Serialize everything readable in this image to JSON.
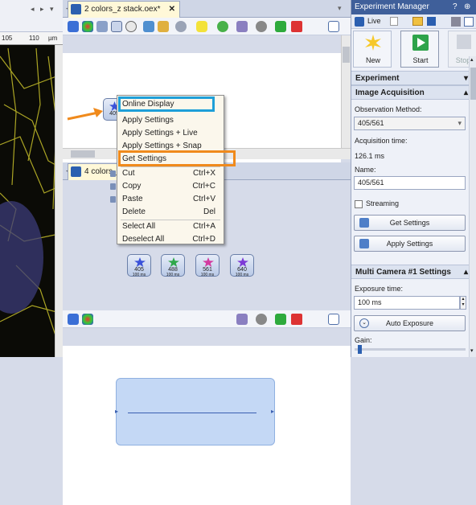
{
  "left_view": {
    "ruler_ticks": [
      "105",
      "110",
      "µm"
    ]
  },
  "workspace": {
    "top_tab": "2 colors_z stack.oex*",
    "bottom_tab": "4 colors_",
    "top_node_label": "405",
    "chain_nodes": [
      {
        "label": "405",
        "sub": "100 ms",
        "color": "#3a52d9"
      },
      {
        "label": "488",
        "sub": "100 ms",
        "color": "#2fa84a"
      },
      {
        "label": "561",
        "sub": "100 ms",
        "color": "#d33aa0"
      },
      {
        "label": "640",
        "sub": "100 ms",
        "color": "#7d3ad6"
      }
    ],
    "highlight_colors": {
      "online_display": "#1e9fd8",
      "get_settings": "#f08a1c",
      "arrow": "#f08a1c"
    }
  },
  "context_menu": {
    "items": [
      {
        "label": "Online Display",
        "shortcut": ""
      },
      {
        "label": "Apply Settings",
        "shortcut": ""
      },
      {
        "label": "Apply Settings + Live",
        "shortcut": ""
      },
      {
        "label": "Apply Settings + Snap",
        "shortcut": ""
      },
      {
        "label": "Get Settings",
        "shortcut": ""
      },
      {
        "label": "Cut",
        "shortcut": "Ctrl+X"
      },
      {
        "label": "Copy",
        "shortcut": "Ctrl+C"
      },
      {
        "label": "Paste",
        "shortcut": "Ctrl+V"
      },
      {
        "label": "Delete",
        "shortcut": "Del"
      },
      {
        "label": "Select All",
        "shortcut": "Ctrl+A"
      },
      {
        "label": "Deselect All",
        "shortcut": "Ctrl+D"
      }
    ]
  },
  "panel": {
    "title": "Experiment Manager",
    "pin_icon": "?",
    "live_label": "Live",
    "big_buttons": [
      {
        "label": "New",
        "icon": "starburst-icon"
      },
      {
        "label": "Start",
        "icon": "play-icon"
      },
      {
        "label": "Stop",
        "icon": "stop-icon"
      }
    ],
    "experiment_label": "Experiment",
    "image_acq": {
      "title": "Image Acquisition",
      "obs_method_label": "Observation Method:",
      "obs_method_value": "405/561",
      "acq_time_label": "Acquisition time:",
      "acq_time_value": "126.1 ms",
      "name_label": "Name:",
      "name_value": "405/561",
      "streaming_label": "Streaming",
      "get_settings_label": "Get Settings",
      "apply_settings_label": "Apply Settings"
    },
    "multi_camera": {
      "title": "Multi Camera #1 Settings",
      "exposure_label": "Exposure time:",
      "exposure_value": "100 ms",
      "auto_exposure_label": "Auto Exposure",
      "gain_label": "Gain:"
    }
  }
}
